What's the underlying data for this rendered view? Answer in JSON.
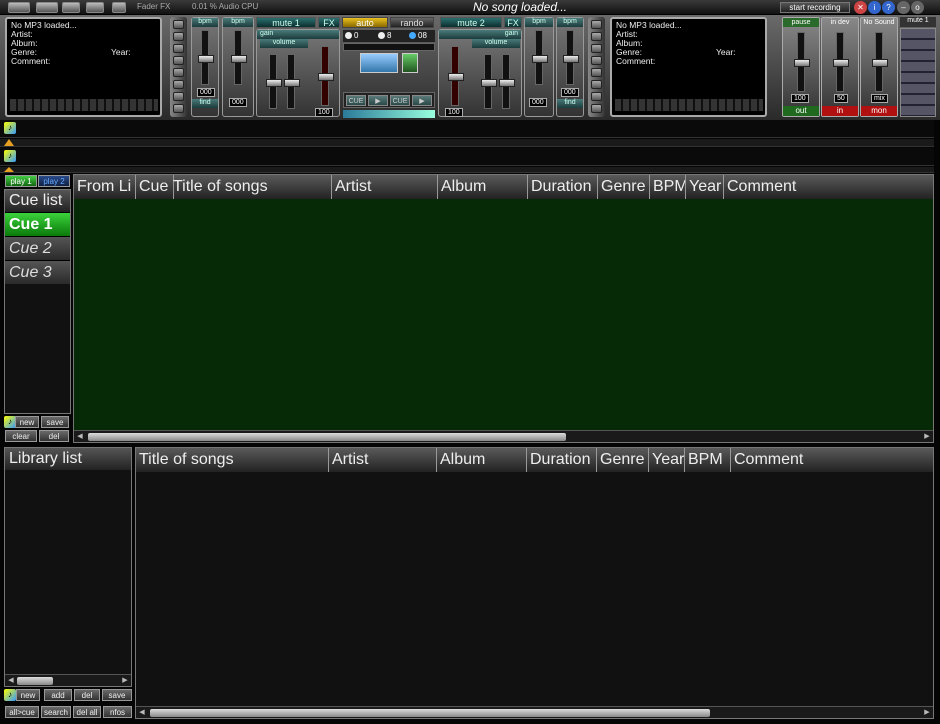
{
  "toolbar": {
    "fader_fx": "Fader FX",
    "audio_cpu": "0.01 % Audio CPU",
    "song_status": "No song loaded...",
    "start_recording": "start recording"
  },
  "deck1": {
    "status": "No MP3 loaded...",
    "artist_label": "Artist:",
    "album_label": "Album:",
    "genre_label": "Genre:",
    "comment_label": "Comment:",
    "year_label": "Year:",
    "bpm_label": "bpm",
    "pitch_value": "000",
    "bpm_value": "000",
    "find_label": "find",
    "mute_label": "mute 1",
    "fx_label": "FX",
    "gain_label": "gain",
    "volume_label": "volume",
    "vol_value": "100"
  },
  "deck2": {
    "status": "No MP3 loaded...",
    "artist_label": "Artist:",
    "album_label": "Album:",
    "genre_label": "Genre:",
    "comment_label": "Comment:",
    "year_label": "Year:",
    "bpm_label": "bpm",
    "pitch_value": "000",
    "bpm_value": "000",
    "find_label": "find",
    "mute_label": "mute 2",
    "fx_label": "FX",
    "gain_label": "gain",
    "volume_label": "volume",
    "vol_value": "100"
  },
  "center": {
    "auto_label": "auto",
    "random_label": "rando",
    "radio_a": "0",
    "radio_b": "8",
    "radio_c": "08",
    "cue_left": "CUE",
    "cue_right": "CUE"
  },
  "master": {
    "out_label": "out",
    "in_label": "in",
    "mon_label": "mon",
    "out_value": "100",
    "in_value": "50",
    "mon_value": "mix",
    "pause_label": "pause",
    "mute_label": "mute 1",
    "in_top": "in dev",
    "mon_top": "No Sound"
  },
  "playlist": {
    "tab1": "play 1",
    "tab2": "play 2",
    "cue_header": "Cue list",
    "cues": [
      "Cue 1",
      "Cue 2",
      "Cue 3"
    ],
    "columns": [
      "From Li",
      "Cue",
      "Title of songs",
      "Artist",
      "Album",
      "Duration",
      "Genre",
      "BPM",
      "Year",
      "Comment"
    ],
    "btn_new": "new",
    "btn_save": "save",
    "btn_clear": "clear",
    "btn_del": "del"
  },
  "library": {
    "header": "Library list",
    "columns": [
      "Title of songs",
      "Artist",
      "Album",
      "Duration",
      "Genre",
      "Year",
      "BPM",
      "Comment"
    ],
    "btn_new": "new",
    "btn_add": "add",
    "btn_del": "del",
    "btn_save": "save",
    "btn_all_cue": "all>cue",
    "btn_search": "search",
    "btn_del_all": "del all",
    "btn_infos": "nfos"
  }
}
